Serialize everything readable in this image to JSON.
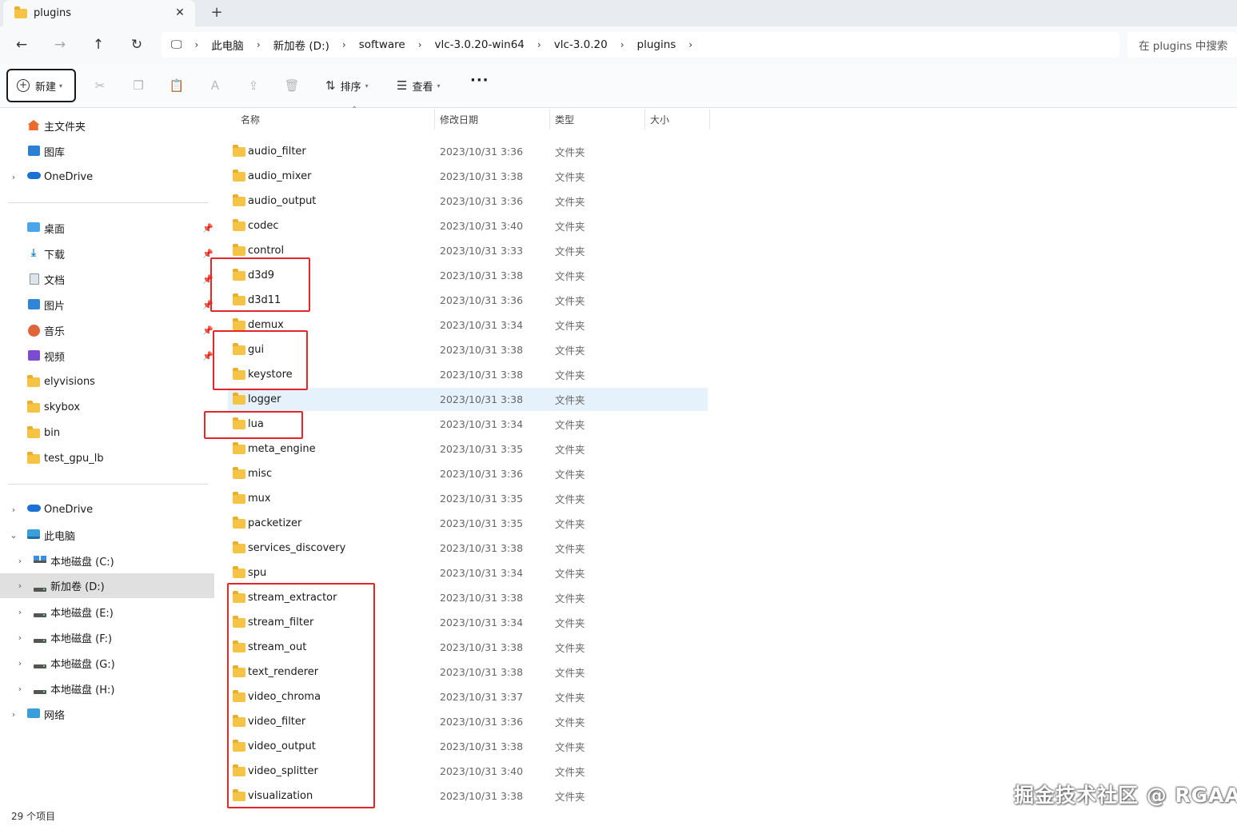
{
  "window": {
    "tab_title": "plugins",
    "tab_close": "✕",
    "new_tab": "+"
  },
  "address": {
    "breadcrumbs": [
      "此电脑",
      "新加卷 (D:)",
      "software",
      "vlc-3.0.20-win64",
      "vlc-3.0.20",
      "plugins"
    ],
    "search_placeholder": "在 plugins 中搜索"
  },
  "toolbar": {
    "new_label": "新建",
    "sort_label": "排序",
    "view_label": "查看",
    "more_label": "···"
  },
  "sidebar": {
    "quick": [
      {
        "label": "主文件夹",
        "icon": "home-icon"
      },
      {
        "label": "图库",
        "icon": "gallery-icon"
      },
      {
        "label": "OneDrive",
        "icon": "onedrive-icon"
      }
    ],
    "pinned": [
      {
        "label": "桌面",
        "icon": "desktop-icon"
      },
      {
        "label": "下载",
        "icon": "download-icon"
      },
      {
        "label": "文档",
        "icon": "document-icon"
      },
      {
        "label": "图片",
        "icon": "pictures-icon"
      },
      {
        "label": "音乐",
        "icon": "music-icon"
      },
      {
        "label": "视频",
        "icon": "video-icon"
      },
      {
        "label": "elyvisions",
        "icon": "folder-icon"
      },
      {
        "label": "skybox",
        "icon": "folder-icon"
      },
      {
        "label": "bin",
        "icon": "folder-icon"
      },
      {
        "label": "test_gpu_lb",
        "icon": "folder-icon"
      }
    ],
    "tree": [
      {
        "label": "OneDrive",
        "icon": "onedrive-icon"
      },
      {
        "label": "此电脑",
        "icon": "pc-icon"
      },
      {
        "label": "本地磁盘 (C:)",
        "icon": "windows-drive-icon"
      },
      {
        "label": "新加卷 (D:)",
        "icon": "drive-icon"
      },
      {
        "label": "本地磁盘 (E:)",
        "icon": "drive-icon"
      },
      {
        "label": "本地磁盘 (F:)",
        "icon": "drive-icon"
      },
      {
        "label": "本地磁盘 (G:)",
        "icon": "drive-icon"
      },
      {
        "label": "本地磁盘 (H:)",
        "icon": "drive-icon"
      },
      {
        "label": "网络",
        "icon": "network-icon"
      }
    ]
  },
  "list": {
    "columns": [
      "名称",
      "修改日期",
      "类型",
      "大小"
    ],
    "rows": [
      {
        "name": "audio_filter",
        "date": "2023/10/31 3:36",
        "type": "文件夹"
      },
      {
        "name": "audio_mixer",
        "date": "2023/10/31 3:38",
        "type": "文件夹"
      },
      {
        "name": "audio_output",
        "date": "2023/10/31 3:36",
        "type": "文件夹"
      },
      {
        "name": "codec",
        "date": "2023/10/31 3:40",
        "type": "文件夹"
      },
      {
        "name": "control",
        "date": "2023/10/31 3:33",
        "type": "文件夹"
      },
      {
        "name": "d3d9",
        "date": "2023/10/31 3:38",
        "type": "文件夹"
      },
      {
        "name": "d3d11",
        "date": "2023/10/31 3:36",
        "type": "文件夹"
      },
      {
        "name": "demux",
        "date": "2023/10/31 3:34",
        "type": "文件夹"
      },
      {
        "name": "gui",
        "date": "2023/10/31 3:38",
        "type": "文件夹"
      },
      {
        "name": "keystore",
        "date": "2023/10/31 3:38",
        "type": "文件夹"
      },
      {
        "name": "logger",
        "date": "2023/10/31 3:38",
        "type": "文件夹"
      },
      {
        "name": "lua",
        "date": "2023/10/31 3:34",
        "type": "文件夹"
      },
      {
        "name": "meta_engine",
        "date": "2023/10/31 3:35",
        "type": "文件夹"
      },
      {
        "name": "misc",
        "date": "2023/10/31 3:36",
        "type": "文件夹"
      },
      {
        "name": "mux",
        "date": "2023/10/31 3:35",
        "type": "文件夹"
      },
      {
        "name": "packetizer",
        "date": "2023/10/31 3:35",
        "type": "文件夹"
      },
      {
        "name": "services_discovery",
        "date": "2023/10/31 3:38",
        "type": "文件夹"
      },
      {
        "name": "spu",
        "date": "2023/10/31 3:34",
        "type": "文件夹"
      },
      {
        "name": "stream_extractor",
        "date": "2023/10/31 3:38",
        "type": "文件夹"
      },
      {
        "name": "stream_filter",
        "date": "2023/10/31 3:34",
        "type": "文件夹"
      },
      {
        "name": "stream_out",
        "date": "2023/10/31 3:38",
        "type": "文件夹"
      },
      {
        "name": "text_renderer",
        "date": "2023/10/31 3:38",
        "type": "文件夹"
      },
      {
        "name": "video_chroma",
        "date": "2023/10/31 3:37",
        "type": "文件夹"
      },
      {
        "name": "video_filter",
        "date": "2023/10/31 3:36",
        "type": "文件夹"
      },
      {
        "name": "video_output",
        "date": "2023/10/31 3:38",
        "type": "文件夹"
      },
      {
        "name": "video_splitter",
        "date": "2023/10/31 3:40",
        "type": "文件夹"
      },
      {
        "name": "visualization",
        "date": "2023/10/31 3:38",
        "type": "文件夹"
      }
    ]
  },
  "status": {
    "item_count": "29 个项目"
  },
  "watermark": "掘金技术社区 @ RGAA",
  "colors": {
    "annotation_red": "#e3262a",
    "folder_yellow": "#f6c445",
    "hover_row": "#e5f1fb"
  }
}
